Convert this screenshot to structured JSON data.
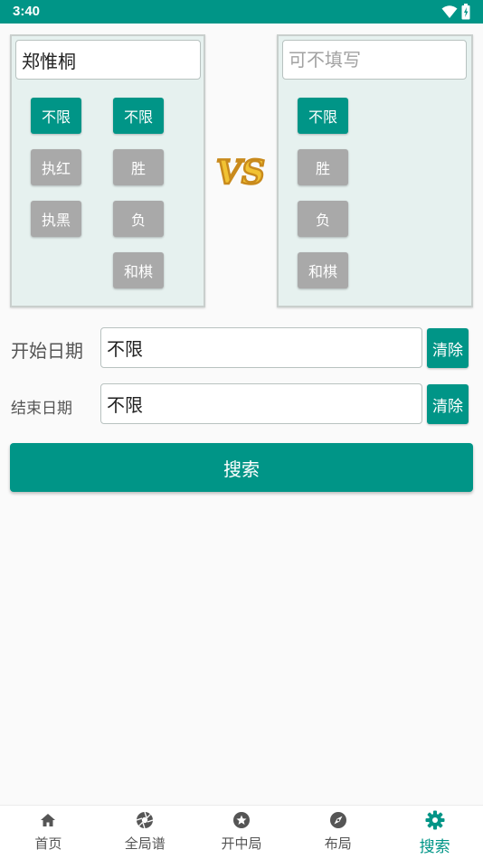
{
  "status_bar": {
    "time": "3:40"
  },
  "player_left": {
    "value": "郑惟桐",
    "placeholder": ""
  },
  "player_right": {
    "value": "",
    "placeholder": "可不填写"
  },
  "left_side_options": {
    "col1": [
      "不限",
      "执红",
      "执黑"
    ],
    "col2": [
      "不限",
      "胜",
      "负",
      "和棋"
    ]
  },
  "right_side_options": [
    "不限",
    "胜",
    "负",
    "和棋"
  ],
  "vs_text": "VS",
  "start_date": {
    "label": "开始日期",
    "value": "不限",
    "clear": "清除"
  },
  "end_date": {
    "label": "结束日期",
    "value": "不限",
    "clear": "清除"
  },
  "search_button": "搜索",
  "nav": [
    {
      "label": "首页",
      "icon": "home-icon"
    },
    {
      "label": "全局谱",
      "icon": "aperture-icon"
    },
    {
      "label": "开中局",
      "icon": "star-circle-icon"
    },
    {
      "label": "布局",
      "icon": "compass-icon"
    },
    {
      "label": "搜索",
      "icon": "gear-icon",
      "active": true
    }
  ],
  "colors": {
    "accent": "#009587",
    "inactive_option": "#a9a9a9",
    "panel_bg": "#e6f1ef"
  }
}
